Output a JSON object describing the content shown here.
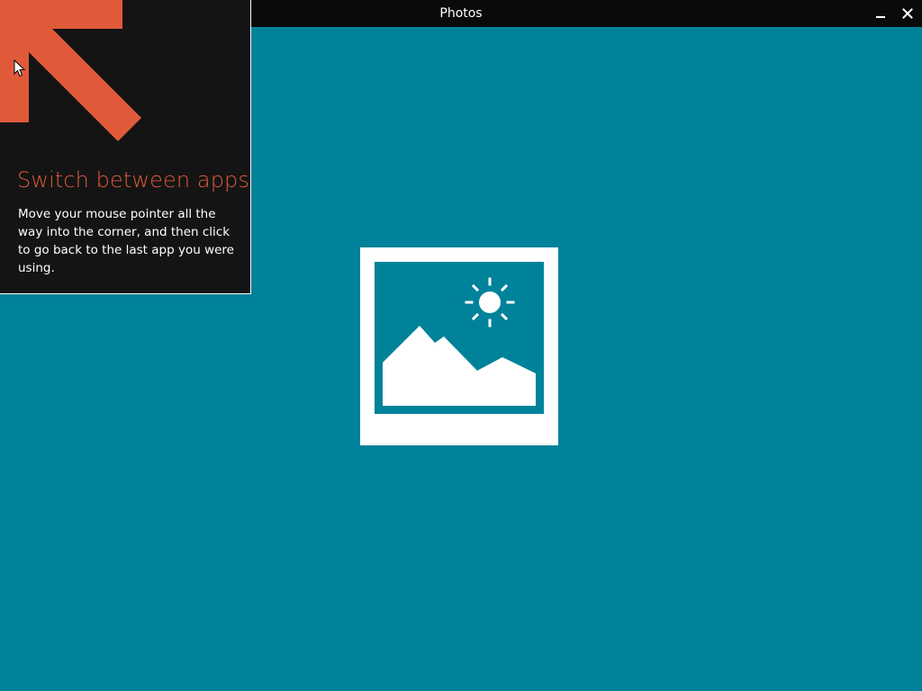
{
  "window": {
    "title": "Photos",
    "background_color": "#00829a",
    "titlebar_color": "#0a0a0a"
  },
  "controls": {
    "minimize_icon": "minimize-icon",
    "close_icon": "close-icon"
  },
  "tip": {
    "title": "Switch between apps",
    "body": "Move your mouse pointer all the way into the corner, and then click to go back to the last app you were using.",
    "accent_color": "#e05a3a",
    "panel_color": "#141414",
    "arrow_icon": "corner-arrow-icon"
  },
  "main": {
    "placeholder_icon": "photo-placeholder-icon"
  }
}
